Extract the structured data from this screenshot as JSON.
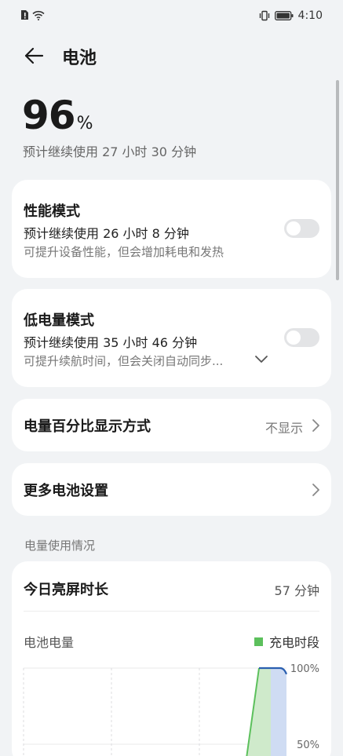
{
  "status_bar": {
    "time": "4:10"
  },
  "app_bar": {
    "title": "电池"
  },
  "battery": {
    "percent": "96",
    "percent_sign": "%",
    "remaining": "预计继续使用 27 小时 30 分钟"
  },
  "performance_mode": {
    "title": "性能模式",
    "estimate": "预计继续使用 26 小时 8 分钟",
    "description": "可提升设备性能，但会增加耗电和发热",
    "enabled": false
  },
  "low_power_mode": {
    "title": "低电量模式",
    "estimate": "预计继续使用 35 小时 46 分钟",
    "description": "可提升续航时间，但会关闭自动同步...",
    "enabled": false
  },
  "percentage_display": {
    "label": "电量百分比显示方式",
    "value": "不显示"
  },
  "more_settings": {
    "label": "更多电池设置"
  },
  "usage_section": {
    "header": "电量使用情况",
    "screen_time_label": "今日亮屏时长",
    "screen_time_value": "57 分钟",
    "chart_label": "电池电量",
    "legend_label": "充电时段"
  },
  "colors": {
    "accent": "#2a5fb0",
    "charging": "#5cc05c",
    "toggle_off": "#e3e4e6"
  },
  "chart_data": {
    "type": "area",
    "y_ticks": [
      "100%",
      "50%"
    ],
    "ylim": [
      0,
      100
    ],
    "series": [
      {
        "name": "充电时段",
        "values": [
          50,
          100
        ]
      },
      {
        "values": [
          100,
          100,
          96
        ]
      }
    ]
  }
}
